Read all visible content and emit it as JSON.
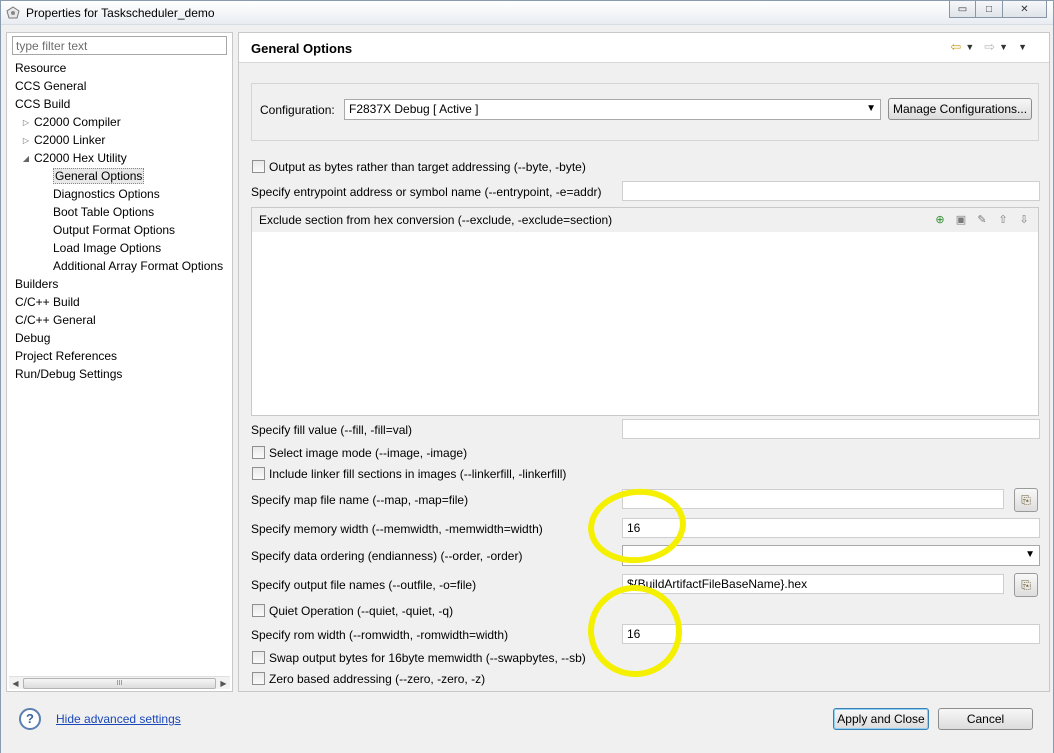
{
  "window": {
    "title": "Properties for Taskscheduler_demo",
    "minimize_glyph": "▭",
    "maximize_glyph": "□",
    "close_glyph": "✕"
  },
  "left": {
    "filter_placeholder": "type filter text",
    "tree": [
      {
        "label": "Resource",
        "level": 0
      },
      {
        "label": "CCS General",
        "level": 0
      },
      {
        "label": "CCS Build",
        "level": 0
      },
      {
        "label": "C2000 Compiler",
        "level": 1,
        "arrow": "▷"
      },
      {
        "label": "C2000 Linker",
        "level": 1,
        "arrow": "▷"
      },
      {
        "label": "C2000 Hex Utility",
        "level": 1,
        "arrow": "◢"
      },
      {
        "label": "General Options",
        "level": 2,
        "selected": true
      },
      {
        "label": "Diagnostics Options",
        "level": 2
      },
      {
        "label": "Boot Table Options",
        "level": 2
      },
      {
        "label": "Output Format Options",
        "level": 2
      },
      {
        "label": "Load Image Options",
        "level": 2
      },
      {
        "label": "Additional Array Format Options",
        "level": 2
      },
      {
        "label": "Builders",
        "level": 0
      },
      {
        "label": "C/C++ Build",
        "level": 0
      },
      {
        "label": "C/C++ General",
        "level": 0
      },
      {
        "label": "Debug",
        "level": 0
      },
      {
        "label": "Project References",
        "level": 0
      },
      {
        "label": "Run/Debug Settings",
        "level": 0
      }
    ],
    "scroll_left": "◀",
    "scroll_right": "▶",
    "scroll_grip": "III"
  },
  "right": {
    "title": "General Options",
    "nav": {
      "back": "⇦",
      "forward": "⇨",
      "dropdown": "▼"
    },
    "configuration_label": "Configuration:",
    "configuration_value": "F2837X Debug  [ Active ]",
    "manage_button": "Manage Configurations...",
    "output_bytes": "Output as bytes rather than target addressing (--byte, -byte)",
    "entrypoint_label": "Specify entrypoint address or symbol name (--entrypoint, -e=addr)",
    "entrypoint_value": "",
    "exclude_title": "Exclude section from hex conversion (--exclude, -exclude=section)",
    "exclude_tools": [
      "add-icon",
      "delete-icon",
      "edit-icon",
      "move-up-icon",
      "move-down-icon"
    ],
    "fill_label": "Specify fill value (--fill, -fill=val)",
    "fill_value": "",
    "image_mode": "Select image mode (--image, -image)",
    "linker_fill": "Include linker fill sections in images (--linkerfill, -linkerfill)",
    "map_label": "Specify map file name (--map, -map=file)",
    "map_value": "",
    "memwidth_label": "Specify memory width (--memwidth, -memwidth=width)",
    "memwidth_value": "16",
    "order_label": "Specify data ordering (endianness) (--order, -order)",
    "order_value": "",
    "outfile_label": "Specify output file names (--outfile, -o=file)",
    "outfile_value": "${BuildArtifactFileBaseName}.hex",
    "quiet": "Quiet Operation (--quiet, -quiet, -q)",
    "romwidth_label": "Specify rom width (--romwidth, -romwidth=width)",
    "romwidth_value": "16",
    "swap": "Swap output bytes for 16byte memwidth (--swapbytes, --sb)",
    "zero": "Zero based addressing (--zero, -zero, -z)"
  },
  "bottom": {
    "help_glyph": "?",
    "hide_advanced": "Hide advanced settings",
    "apply_close": "Apply and Close",
    "cancel": "Cancel"
  },
  "colors": {
    "highlight_marker": "#f4f000",
    "link": "#1a47b8"
  }
}
